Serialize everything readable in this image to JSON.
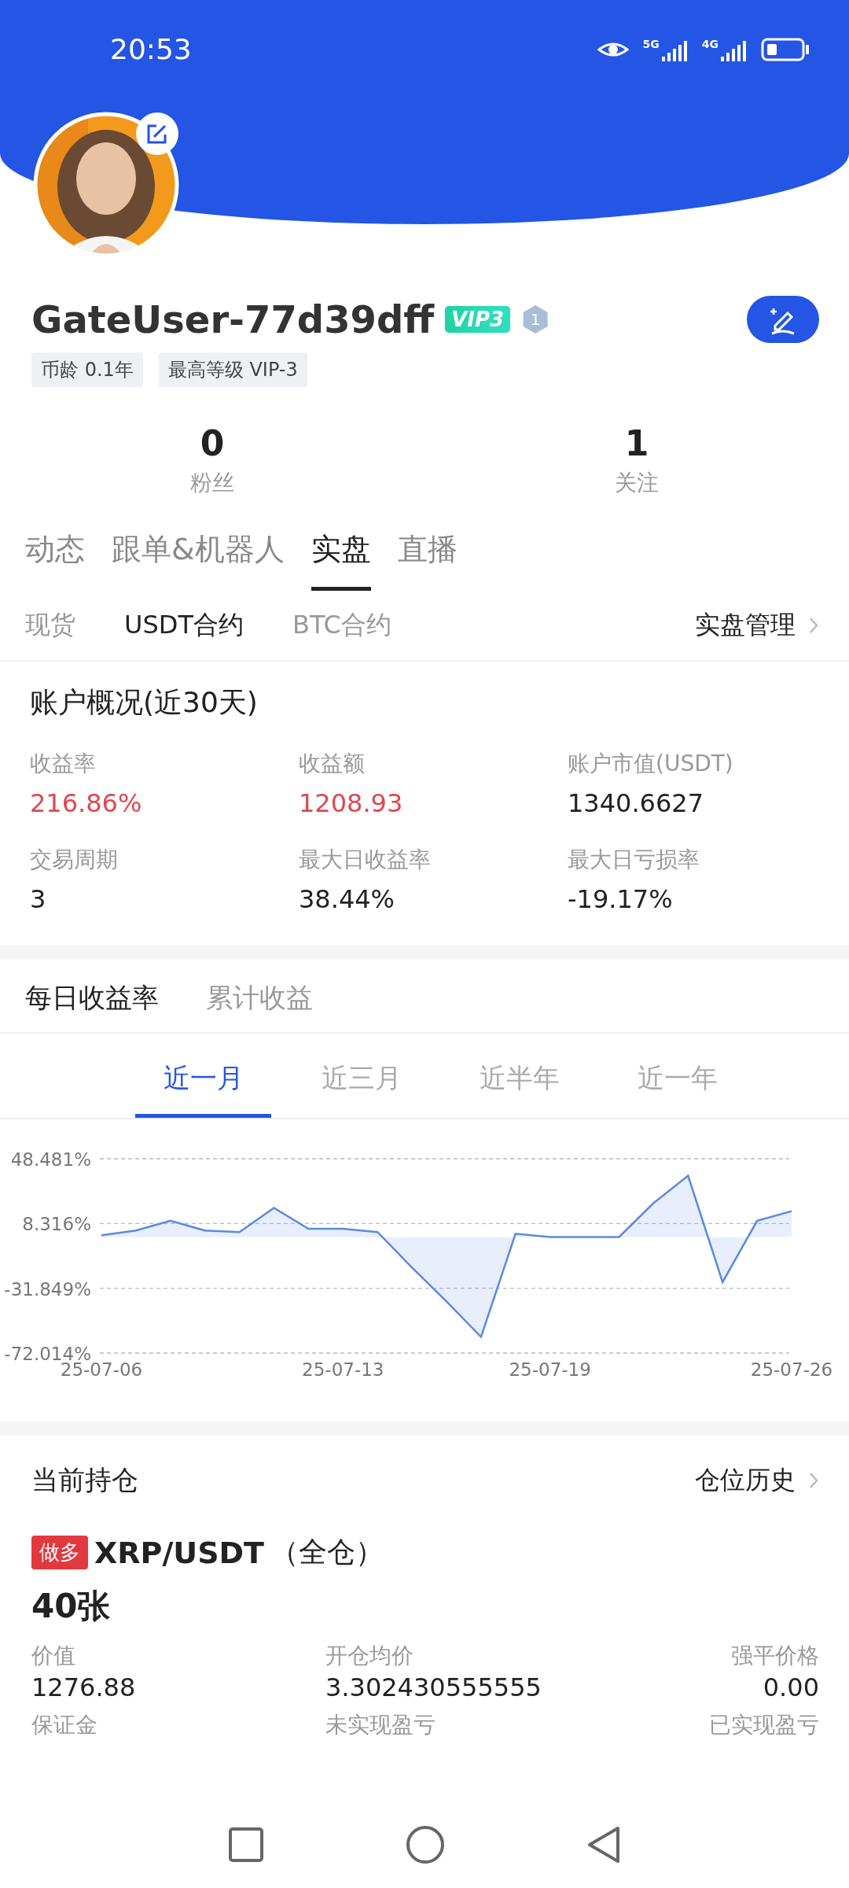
{
  "status_bar": {
    "time": "20:53",
    "network_1": "5G",
    "network_2": "4G"
  },
  "profile": {
    "avatar": {
      "kind": "picture"
    },
    "name": "GateUser-77d39dff",
    "vip_badge": "VIP3",
    "level_badge": "1",
    "tags": [
      "币龄 0.1年",
      "最高等级 VIP-3"
    ]
  },
  "stats": [
    {
      "value": "0",
      "label": "粉丝"
    },
    {
      "value": "1",
      "label": "关注"
    }
  ],
  "tabs": [
    {
      "label": "动态",
      "selected": false
    },
    {
      "label": "跟单&机器人",
      "selected": false
    },
    {
      "label": "实盘",
      "selected": true
    },
    {
      "label": "直播",
      "selected": false
    }
  ],
  "sub_tabs": [
    {
      "label": "现货",
      "selected": false
    },
    {
      "label": "USDT合约",
      "selected": true
    },
    {
      "label": "BTC合约",
      "selected": false
    }
  ],
  "manage_link": "实盘管理",
  "overview": {
    "title": "账户概况(近30天)",
    "metrics": [
      {
        "label": "收益率",
        "value": "216.86%",
        "highlight": true
      },
      {
        "label": "收益额",
        "value": "1208.93",
        "highlight": true
      },
      {
        "label": "账户市值(USDT)",
        "value": "1340.6627",
        "highlight": false
      },
      {
        "label": "交易周期",
        "value": "3",
        "highlight": false
      },
      {
        "label": "最大日收益率",
        "value": "38.44%",
        "highlight": false
      },
      {
        "label": "最大日亏损率",
        "value": "-19.17%",
        "highlight": false
      }
    ]
  },
  "chart_tabs": [
    {
      "label": "每日收益率",
      "selected": true
    },
    {
      "label": "累计收益",
      "selected": false
    }
  ],
  "periods": [
    {
      "label": "近一月",
      "selected": true
    },
    {
      "label": "近三月",
      "selected": false
    },
    {
      "label": "近半年",
      "selected": false
    },
    {
      "label": "近一年",
      "selected": false
    }
  ],
  "chart": {
    "chart_data": {
      "type": "line",
      "categories": [
        "25-07-06",
        null,
        null,
        null,
        null,
        null,
        null,
        "25-07-13",
        null,
        null,
        null,
        null,
        null,
        "25-07-19",
        null,
        null,
        null,
        null,
        null,
        null,
        "25-07-26"
      ],
      "series": [
        {
          "color": "#5a8ae0",
          "values": [
            1,
            4,
            10,
            4,
            3,
            18,
            5,
            5,
            3,
            -19,
            -40,
            -62,
            2,
            0,
            0,
            0,
            21,
            38,
            -28,
            10,
            16
          ]
        }
      ],
      "ylim": [
        -72.014,
        48.481
      ],
      "yticks": [
        {
          "value": 48.481,
          "label": "48.481%"
        },
        {
          "value": 8.316,
          "label": "8.316%"
        },
        {
          "value": -31.849,
          "label": "-31.849%"
        },
        {
          "value": -72.014,
          "label": "-72.014%"
        }
      ]
    }
  },
  "positions": {
    "title": "当前持仓",
    "history_link": "仓位历史",
    "items": [
      {
        "side": "做多",
        "symbol": "XRP/USDT",
        "mode": "（全仓）",
        "size": "40张",
        "fields": [
          {
            "label": "价值",
            "value": "1276.88"
          },
          {
            "label": "开仓均价",
            "value": "3.302430555555"
          },
          {
            "label": "强平价格",
            "value": "0.00"
          },
          {
            "label": "保证金"
          },
          {
            "label": "未实现盈亏"
          },
          {
            "label": "已实现盈亏"
          }
        ]
      }
    ]
  }
}
